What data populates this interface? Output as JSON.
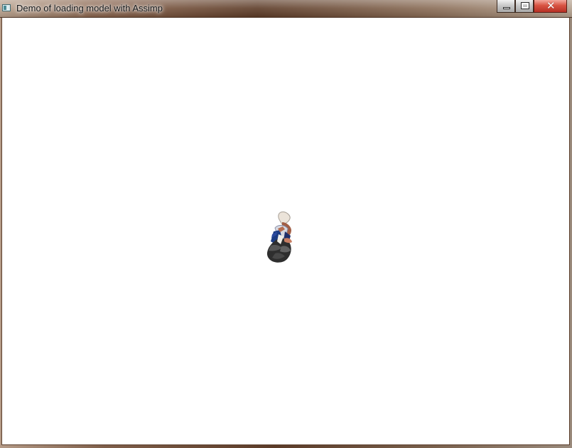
{
  "window": {
    "title": "Demo of loading model with Assimp",
    "controls": {
      "minimize_icon": "minimize-icon",
      "maximize_icon": "maximize-icon",
      "close_icon": "close-icon",
      "close_glyph": "✕"
    }
  },
  "viewport": {
    "background": "#ffffff",
    "model": {
      "description_icon": "rendered-3d-character-model",
      "colors": {
        "hair": "#e9e1d6",
        "skin": "#ad6a50",
        "coat": "#213c82",
        "cloth": "#b8c1db",
        "base": "#2d2d2d"
      }
    }
  },
  "theme": {
    "titlebar_start": "#b8a18d",
    "titlebar_mid": "#5d3c28",
    "titlebar_end": "#b4a18f",
    "close_red": "#d85443"
  }
}
